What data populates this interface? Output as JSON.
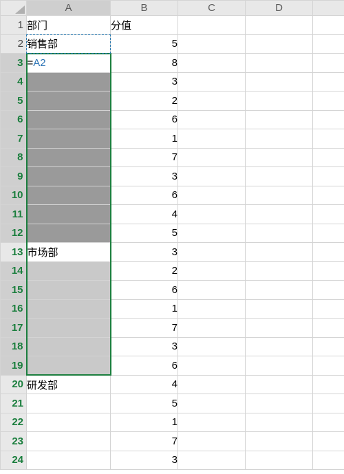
{
  "columns": {
    "A": "A",
    "B": "B",
    "C": "C",
    "D": "D"
  },
  "headers": {
    "dept": "部门",
    "score": "分值"
  },
  "active_cell_formula": {
    "prefix": "=",
    "ref": "A2"
  },
  "rows": [
    {
      "n": 1,
      "A": "部门",
      "B": "分值"
    },
    {
      "n": 2,
      "A": "销售部",
      "B": "5"
    },
    {
      "n": 3,
      "A": "",
      "B": "8"
    },
    {
      "n": 4,
      "A": "",
      "B": "3"
    },
    {
      "n": 5,
      "A": "",
      "B": "2"
    },
    {
      "n": 6,
      "A": "",
      "B": "6"
    },
    {
      "n": 7,
      "A": "",
      "B": "1"
    },
    {
      "n": 8,
      "A": "",
      "B": "7"
    },
    {
      "n": 9,
      "A": "",
      "B": "3"
    },
    {
      "n": 10,
      "A": "",
      "B": "6"
    },
    {
      "n": 11,
      "A": "",
      "B": "4"
    },
    {
      "n": 12,
      "A": "",
      "B": "5"
    },
    {
      "n": 13,
      "A": "市场部",
      "B": "3"
    },
    {
      "n": 14,
      "A": "",
      "B": "2"
    },
    {
      "n": 15,
      "A": "",
      "B": "6"
    },
    {
      "n": 16,
      "A": "",
      "B": "1"
    },
    {
      "n": 17,
      "A": "",
      "B": "7"
    },
    {
      "n": 18,
      "A": "",
      "B": "3"
    },
    {
      "n": 19,
      "A": "",
      "B": "6"
    },
    {
      "n": 20,
      "A": "研发部",
      "B": "4"
    },
    {
      "n": 21,
      "A": "",
      "B": "5"
    },
    {
      "n": 22,
      "A": "",
      "B": "1"
    },
    {
      "n": 23,
      "A": "",
      "B": "7"
    },
    {
      "n": 24,
      "A": "",
      "B": "3"
    }
  ],
  "copied_cell": "A2",
  "selection_range": "A3:A19",
  "active_cell": "A3"
}
